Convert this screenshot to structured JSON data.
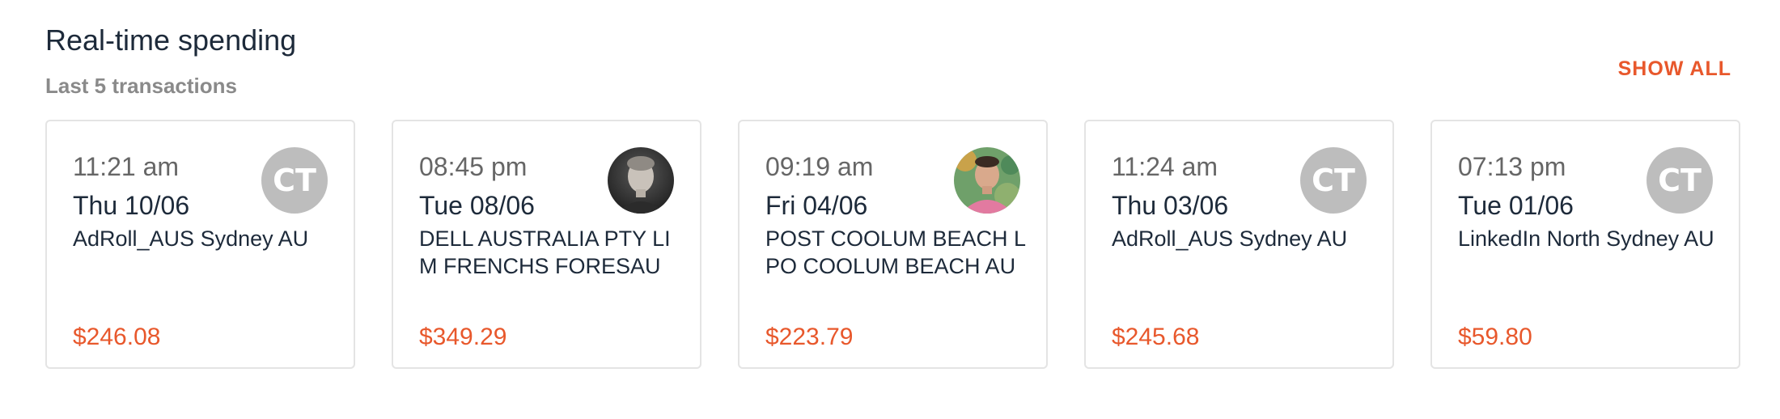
{
  "header": {
    "title": "Real-time spending",
    "subtitle": "Last 5 transactions",
    "show_all_label": "SHOW ALL"
  },
  "colors": {
    "accent": "#e8582c",
    "title_text": "#1d2a3a",
    "muted_text": "#8a8a8a",
    "avatar_bg": "#bdbdbd",
    "card_border": "#e4e4e4"
  },
  "transactions": [
    {
      "time": "11:21 am",
      "date": "Thu 10/06",
      "merchant": "AdRoll_AUS Sydney AU",
      "amount": "$246.08",
      "avatar": {
        "type": "initials",
        "initials": "CT"
      }
    },
    {
      "time": "08:45 pm",
      "date": "Tue 08/06",
      "merchant": "DELL AUSTRALIA PTY LIM FRENCHS FORESAU",
      "amount": "$349.29",
      "avatar": {
        "type": "photo",
        "icon": "person-photo-icon"
      }
    },
    {
      "time": "09:19 am",
      "date": "Fri 04/06",
      "merchant": "POST COOLUM BEACH LPO COOLUM BEACH AU",
      "amount": "$223.79",
      "avatar": {
        "type": "photo",
        "icon": "person-photo-icon"
      }
    },
    {
      "time": "11:24 am",
      "date": "Thu 03/06",
      "merchant": "AdRoll_AUS Sydney AU",
      "amount": "$245.68",
      "avatar": {
        "type": "initials",
        "initials": "CT"
      }
    },
    {
      "time": "07:13 pm",
      "date": "Tue 01/06",
      "merchant": "LinkedIn North Sydney AU",
      "amount": "$59.80",
      "avatar": {
        "type": "initials",
        "initials": "CT"
      }
    }
  ]
}
